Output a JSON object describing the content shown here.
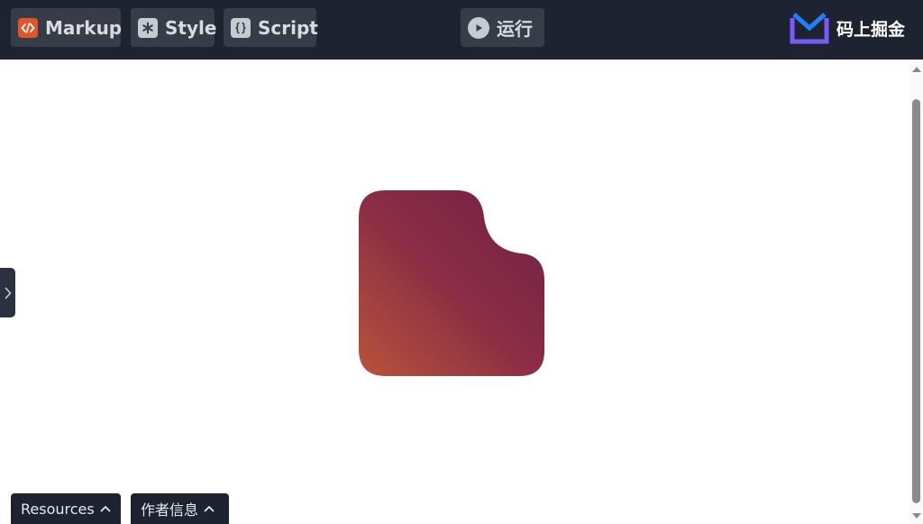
{
  "toolbar": {
    "markup_label": "Markup",
    "style_label": "Style",
    "script_label": "Script",
    "run_label": "运行"
  },
  "brand": {
    "name": "码上掘金"
  },
  "footer": {
    "resources_label": "Resources",
    "author_label": "作者信息"
  },
  "colors": {
    "topbar": "#1d2330",
    "gradient_start": "#b8533a",
    "gradient_end": "#6f1f45",
    "logo_accent": "#1e80ff",
    "logo_tray": "#7a5af8"
  },
  "icons": {
    "markup": "code-icon",
    "style": "asterisk-icon",
    "script": "braces-icon",
    "run": "play-icon",
    "side": "chevron-right-icon",
    "footer": "chevron-up-icon"
  }
}
